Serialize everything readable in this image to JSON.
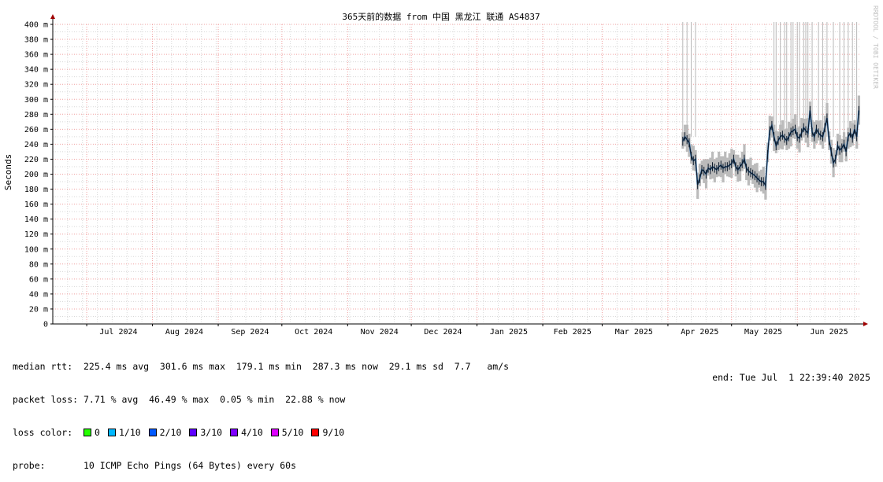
{
  "chart_data": {
    "type": "line",
    "title": "365天前的数据 from 中国 黑龙江 联通 AS4837",
    "ylabel": "Seconds",
    "watermark": "RRDTOOL / TOBI OETIKER",
    "ylim": [
      0,
      400
    ],
    "yticks": [
      {
        "v": 0,
        "label": "0"
      },
      {
        "v": 20,
        "label": "20 m"
      },
      {
        "v": 40,
        "label": "40 m"
      },
      {
        "v": 60,
        "label": "60 m"
      },
      {
        "v": 80,
        "label": "80 m"
      },
      {
        "v": 100,
        "label": "100 m"
      },
      {
        "v": 120,
        "label": "120 m"
      },
      {
        "v": 140,
        "label": "140 m"
      },
      {
        "v": 160,
        "label": "160 m"
      },
      {
        "v": 180,
        "label": "180 m"
      },
      {
        "v": 200,
        "label": "200 m"
      },
      {
        "v": 220,
        "label": "220 m"
      },
      {
        "v": 240,
        "label": "240 m"
      },
      {
        "v": 260,
        "label": "260 m"
      },
      {
        "v": 280,
        "label": "280 m"
      },
      {
        "v": 300,
        "label": "300 m"
      },
      {
        "v": 320,
        "label": "320 m"
      },
      {
        "v": 340,
        "label": "340 m"
      },
      {
        "v": 360,
        "label": "360 m"
      },
      {
        "v": 380,
        "label": "380 m"
      },
      {
        "v": 400,
        "label": "400 m"
      }
    ],
    "xrange": [
      "2024-06-15",
      "2025-07-01"
    ],
    "months": [
      {
        "start": "2024-06-15",
        "label": "",
        "center": ""
      },
      {
        "start": "2024-07-01",
        "label": "Jul 2024",
        "center": "2024-07-16"
      },
      {
        "start": "2024-08-01",
        "label": "Aug 2024",
        "center": "2024-08-16"
      },
      {
        "start": "2024-09-01",
        "label": "Sep 2024",
        "center": "2024-09-16"
      },
      {
        "start": "2024-10-01",
        "label": "Oct 2024",
        "center": "2024-10-16"
      },
      {
        "start": "2024-11-01",
        "label": "Nov 2024",
        "center": "2024-11-16"
      },
      {
        "start": "2024-12-01",
        "label": "Dec 2024",
        "center": "2024-12-16"
      },
      {
        "start": "2025-01-01",
        "label": "Jan 2025",
        "center": "2025-01-16"
      },
      {
        "start": "2025-02-01",
        "label": "Feb 2025",
        "center": "2025-02-15"
      },
      {
        "start": "2025-03-01",
        "label": "Mar 2025",
        "center": "2025-03-16"
      },
      {
        "start": "2025-04-01",
        "label": "Apr 2025",
        "center": "2025-04-16"
      },
      {
        "start": "2025-05-01",
        "label": "May 2025",
        "center": "2025-05-16"
      },
      {
        "start": "2025-06-01",
        "label": "Jun 2025",
        "center": "2025-06-16"
      }
    ],
    "series": [
      {
        "values": [
          [
            "2025-04-08",
            244
          ],
          [
            "2025-04-09",
            250
          ],
          [
            "2025-04-10",
            246
          ],
          [
            "2025-04-11",
            242
          ],
          [
            "2025-04-12",
            224
          ],
          [
            "2025-04-13",
            218
          ],
          [
            "2025-04-14",
            220
          ],
          [
            "2025-04-15",
            186
          ],
          [
            "2025-04-16",
            194
          ],
          [
            "2025-04-17",
            206
          ],
          [
            "2025-04-18",
            204
          ],
          [
            "2025-04-19",
            200
          ],
          [
            "2025-04-20",
            208
          ],
          [
            "2025-04-21",
            206
          ],
          [
            "2025-04-22",
            210
          ],
          [
            "2025-04-23",
            208
          ],
          [
            "2025-04-24",
            206
          ],
          [
            "2025-04-25",
            210
          ],
          [
            "2025-04-26",
            212
          ],
          [
            "2025-04-27",
            208
          ],
          [
            "2025-04-28",
            210
          ],
          [
            "2025-04-29",
            210
          ],
          [
            "2025-04-30",
            212
          ],
          [
            "2025-05-01",
            214
          ],
          [
            "2025-05-02",
            220
          ],
          [
            "2025-05-03",
            210
          ],
          [
            "2025-05-04",
            206
          ],
          [
            "2025-05-05",
            210
          ],
          [
            "2025-05-06",
            214
          ],
          [
            "2025-05-07",
            220
          ],
          [
            "2025-05-08",
            208
          ],
          [
            "2025-05-09",
            204
          ],
          [
            "2025-05-10",
            202
          ],
          [
            "2025-05-11",
            200
          ],
          [
            "2025-05-12",
            198
          ],
          [
            "2025-05-13",
            195
          ],
          [
            "2025-05-14",
            192
          ],
          [
            "2025-05-15",
            190
          ],
          [
            "2025-05-16",
            190
          ],
          [
            "2025-05-17",
            185
          ],
          [
            "2025-05-18",
            226
          ],
          [
            "2025-05-19",
            258
          ],
          [
            "2025-05-20",
            265
          ],
          [
            "2025-05-21",
            250
          ],
          [
            "2025-05-22",
            238
          ],
          [
            "2025-05-23",
            245
          ],
          [
            "2025-05-24",
            250
          ],
          [
            "2025-05-25",
            252
          ],
          [
            "2025-05-26",
            248
          ],
          [
            "2025-05-27",
            245
          ],
          [
            "2025-05-28",
            250
          ],
          [
            "2025-05-29",
            256
          ],
          [
            "2025-05-30",
            258
          ],
          [
            "2025-05-31",
            260
          ],
          [
            "2025-06-01",
            250
          ],
          [
            "2025-06-02",
            248
          ],
          [
            "2025-06-03",
            255
          ],
          [
            "2025-06-04",
            262
          ],
          [
            "2025-06-05",
            258
          ],
          [
            "2025-06-06",
            255
          ],
          [
            "2025-06-07",
            285
          ],
          [
            "2025-06-08",
            256
          ],
          [
            "2025-06-09",
            250
          ],
          [
            "2025-06-10",
            260
          ],
          [
            "2025-06-11",
            255
          ],
          [
            "2025-06-12",
            252
          ],
          [
            "2025-06-13",
            250
          ],
          [
            "2025-06-14",
            262
          ],
          [
            "2025-06-15",
            275
          ],
          [
            "2025-06-16",
            245
          ],
          [
            "2025-06-17",
            230
          ],
          [
            "2025-06-18",
            215
          ],
          [
            "2025-06-19",
            220
          ],
          [
            "2025-06-20",
            238
          ],
          [
            "2025-06-21",
            232
          ],
          [
            "2025-06-22",
            235
          ],
          [
            "2025-06-23",
            240
          ],
          [
            "2025-06-24",
            230
          ],
          [
            "2025-06-25",
            250
          ],
          [
            "2025-06-26",
            255
          ],
          [
            "2025-06-27",
            248
          ],
          [
            "2025-06-28",
            260
          ],
          [
            "2025-06-29",
            250
          ],
          [
            "2025-06-30",
            285
          ]
        ]
      }
    ],
    "loss_spikes": [
      "2025-04-08",
      "2025-04-10",
      "2025-04-12",
      "2025-04-14",
      "2025-05-21",
      "2025-05-22",
      "2025-05-24",
      "2025-05-26",
      "2025-05-27",
      "2025-05-29",
      "2025-05-30",
      "2025-06-01",
      "2025-06-02",
      "2025-06-04",
      "2025-06-05",
      "2025-06-06",
      "2025-06-08",
      "2025-06-11",
      "2025-06-13",
      "2025-06-15",
      "2025-06-18",
      "2025-06-21",
      "2025-06-23",
      "2025-06-25",
      "2025-06-27",
      "2025-06-29"
    ],
    "colors": {
      "grid_major": "#f0a0a0",
      "grid_minor": "#d8d8d8",
      "axis": "#000000",
      "arrow": "#a00000",
      "smoke": "#bbbbbb",
      "median": "#0d1a2a",
      "median_hi": "#1e7fd8",
      "spike": "#b8b8b8"
    }
  },
  "stats": {
    "median_rtt": "median rtt:  225.4 ms avg  301.6 ms max  179.1 ms min  287.3 ms now  29.1 ms sd  7.7   am/s",
    "packet_loss": "packet loss: 7.71 % avg  46.49 % max  0.05 % min  22.88 % now",
    "loss_color_label": "loss color:",
    "loss_colors": [
      {
        "label": "0",
        "color": "#26ff00"
      },
      {
        "label": "1/10",
        "color": "#00b8ff"
      },
      {
        "label": "2/10",
        "color": "#0059ff"
      },
      {
        "label": "3/10",
        "color": "#5e00ff"
      },
      {
        "label": "4/10",
        "color": "#7e00ff"
      },
      {
        "label": "5/10",
        "color": "#dd00ff"
      },
      {
        "label": "9/10",
        "color": "#ff0000"
      }
    ],
    "probe": "probe:       10 ICMP Echo Pings (64 Bytes) every 60s",
    "end": "end: Tue Jul  1 22:39:40 2025"
  }
}
